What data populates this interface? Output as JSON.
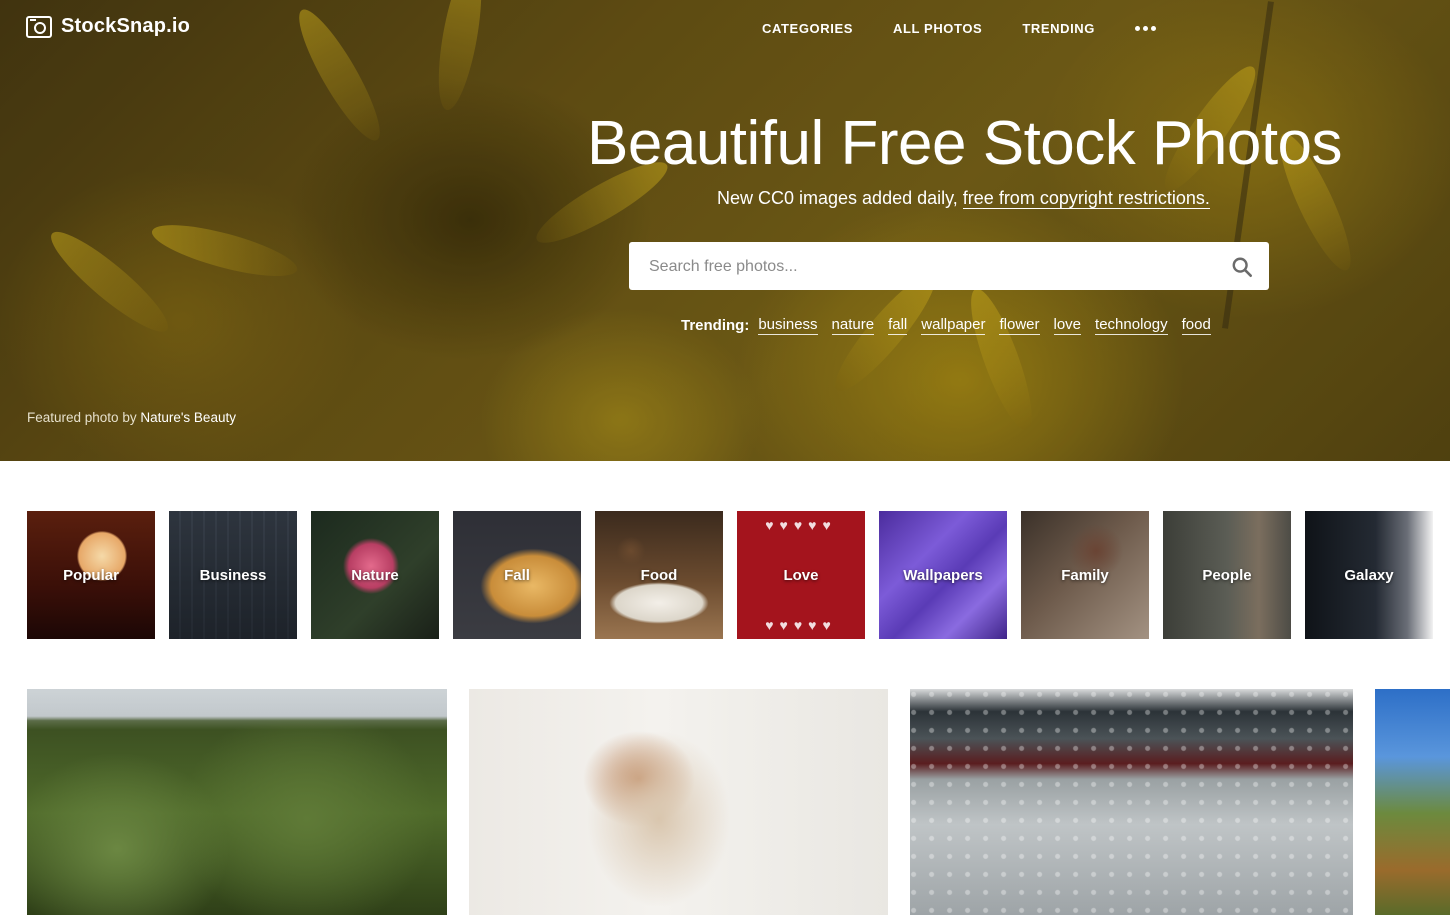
{
  "brand": {
    "name": "StockSnap.io"
  },
  "nav": {
    "items": [
      "CATEGORIES",
      "ALL PHOTOS",
      "TRENDING"
    ]
  },
  "hero": {
    "title": "Beautiful Free Stock Photos",
    "subtitle_plain": "New CC0 images added daily, ",
    "subtitle_link": "free from copyright restrictions.",
    "search_placeholder": "Search free photos...",
    "trending_label": "Trending:",
    "trending_tags": [
      "business",
      "nature",
      "fall",
      "wallpaper",
      "flower",
      "love",
      "technology",
      "food"
    ],
    "credit_prefix": "Featured photo by ",
    "credit_author": "Nature's Beauty"
  },
  "categories": [
    "Popular",
    "Business",
    "Nature",
    "Fall",
    "Food",
    "Love",
    "Wallpapers",
    "Family",
    "People",
    "Galaxy"
  ]
}
